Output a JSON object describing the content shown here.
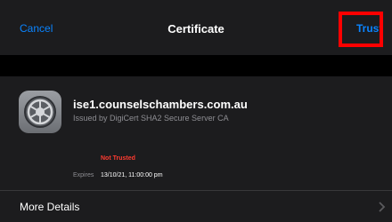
{
  "nav": {
    "cancel_label": "Cancel",
    "title": "Certificate",
    "trust_label": "Trust"
  },
  "certificate": {
    "icon": "certificate-gear-icon",
    "name": "ise1.counselschambers.com.au",
    "issuer": "Issued by DigiCert SHA2 Secure Server CA",
    "status": "Not Trusted",
    "expires_label": "Expires",
    "expires_value": "13/10/21, 11:00:00 pm"
  },
  "details": {
    "label": "More Details",
    "icon": "chevron-right-icon"
  },
  "colors": {
    "accent": "#0a84ff",
    "warning": "#ff3b30",
    "highlight": "#ff0000",
    "background": "#000000",
    "panel": "#1c1c1e"
  }
}
